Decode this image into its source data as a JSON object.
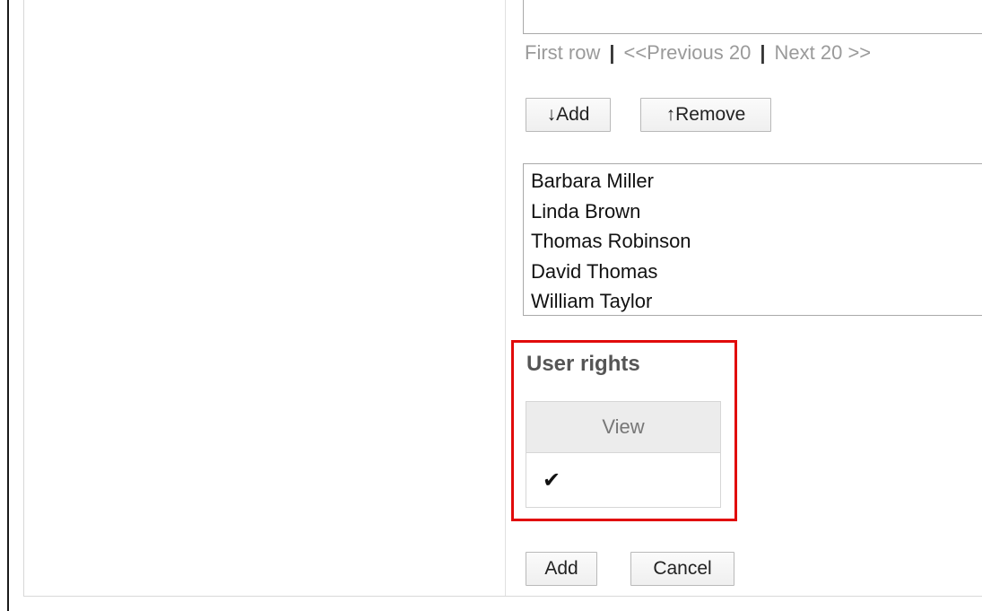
{
  "pager": {
    "first": "First row",
    "sep1": "|",
    "previous": "<<Previous 20",
    "sep2": "|",
    "next": "Next 20 >>"
  },
  "list_buttons": {
    "add": "↓Add",
    "remove": "↑Remove"
  },
  "selected_users": [
    "Barbara Miller",
    "Linda Brown",
    "Thomas Robinson",
    "David Thomas",
    "William Taylor"
  ],
  "user_rights": {
    "title": "User rights",
    "column": "View",
    "view_checked": "✔"
  },
  "form_buttons": {
    "add": "Add",
    "cancel": "Cancel"
  },
  "colors": {
    "highlight": "#e10b0b",
    "header_bg": "#ececec"
  }
}
